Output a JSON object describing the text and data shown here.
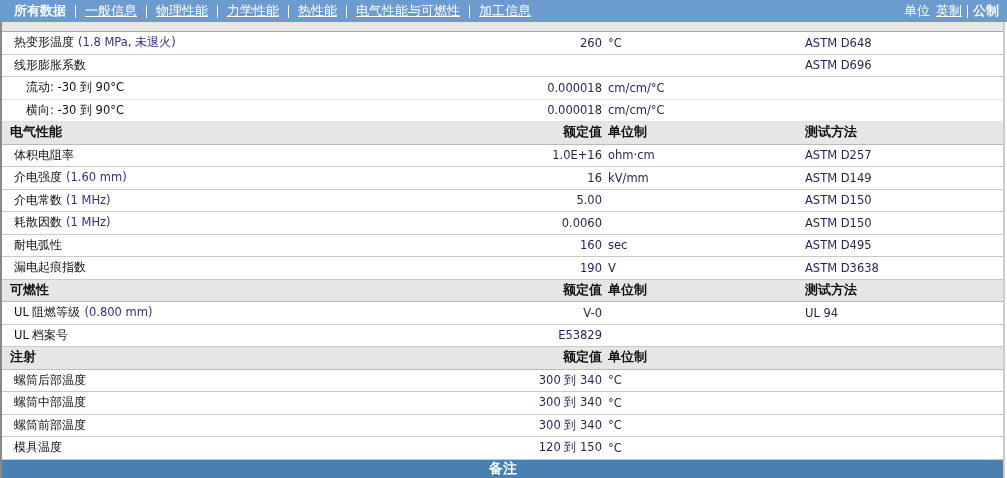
{
  "nav": {
    "tabs": [
      {
        "label": "所有数据",
        "selected": true
      },
      {
        "label": "一般信息",
        "selected": false
      },
      {
        "label": "物理性能",
        "selected": false
      },
      {
        "label": "力学性能",
        "selected": false
      },
      {
        "label": "热性能",
        "selected": false
      },
      {
        "label": "电气性能与可燃性",
        "selected": false
      },
      {
        "label": "加工信息",
        "selected": false
      }
    ],
    "units_label": "单位",
    "units": [
      {
        "label": "英制",
        "selected": false
      },
      {
        "label": "公制",
        "selected": true
      }
    ]
  },
  "sections": [
    {
      "rows": [
        {
          "label": "热变形温度",
          "condition": "(1.8 MPa, 未退火)",
          "value": "260",
          "unit": "°C",
          "method": "ASTM D648"
        },
        {
          "label": "线形膨胀系数",
          "method": "ASTM D696",
          "children": [
            {
              "label": "流动: -30 到  90°C",
              "value": "0.000018",
              "unit": "cm/cm/°C"
            },
            {
              "label": "横向: -30 到  90°C",
              "value": "0.000018",
              "unit": "cm/cm/°C"
            }
          ]
        }
      ]
    },
    {
      "title": "电气性能",
      "headings": {
        "value": "额定值",
        "unit": "单位制",
        "method": "测试方法"
      },
      "rows": [
        {
          "label": "体积电阻率",
          "value": "1.0E+16",
          "unit": "ohm·cm",
          "method": "ASTM D257"
        },
        {
          "label": "介电强度",
          "condition": "(1.60 mm)",
          "value": "16",
          "unit": "kV/mm",
          "method": "ASTM D149"
        },
        {
          "label": "介电常数",
          "condition": "(1 MHz)",
          "value": "5.00",
          "method": "ASTM D150"
        },
        {
          "label": "耗散因数",
          "condition": "(1 MHz)",
          "value": "0.0060",
          "method": "ASTM D150"
        },
        {
          "label": "耐电弧性",
          "value": "160",
          "unit": "sec",
          "method": "ASTM D495"
        },
        {
          "label": "漏电起痕指数",
          "value": "190",
          "unit": "V",
          "method": "ASTM D3638"
        }
      ]
    },
    {
      "title": "可燃性",
      "headings": {
        "value": "额定值",
        "unit": "单位制",
        "method": "测试方法"
      },
      "rows": [
        {
          "label": "UL 阻燃等级",
          "condition": "(0.800 mm)",
          "value": "V-0",
          "method": "UL 94"
        },
        {
          "label": "UL 档案号",
          "value": "E53829"
        }
      ]
    },
    {
      "title": "注射",
      "headings": {
        "value": "额定值",
        "unit": "单位制"
      },
      "rows": [
        {
          "label": "螺筒后部温度",
          "value": "300 到  340",
          "unit": "°C"
        },
        {
          "label": "螺筒中部温度",
          "value": "300 到  340",
          "unit": "°C"
        },
        {
          "label": "螺筒前部温度",
          "value": "300 到  340",
          "unit": "°C"
        },
        {
          "label": "模具温度",
          "value": "120 到  150",
          "unit": "°C"
        }
      ]
    }
  ],
  "footer": {
    "title": "备注"
  }
}
